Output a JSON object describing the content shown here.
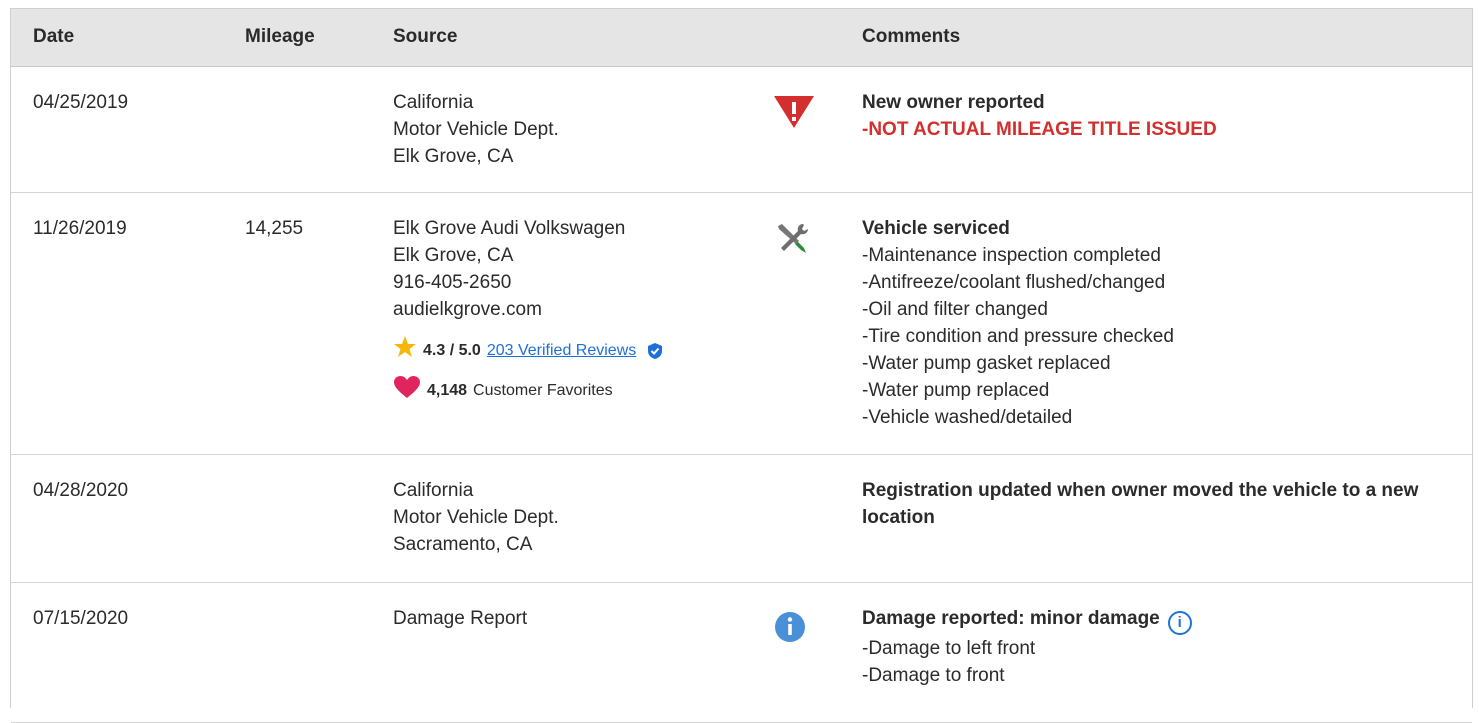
{
  "table": {
    "headers": {
      "date": "Date",
      "mileage": "Mileage",
      "source": "Source",
      "comments": "Comments"
    },
    "rows": [
      {
        "date": "04/25/2019",
        "mileage": "",
        "source": [
          "California",
          "Motor Vehicle Dept.",
          "Elk Grove, CA"
        ],
        "icon": "warning-triangle-icon",
        "comment_title": "New owner reported",
        "comment_items": [
          "-NOT ACTUAL MILEAGE TITLE ISSUED"
        ]
      },
      {
        "date": "11/26/2019",
        "mileage": "14,255",
        "source": [
          "Elk Grove Audi Volkswagen",
          "Elk Grove, CA",
          "916-405-2650",
          "audielkgrove.com"
        ],
        "rating": "4.3 / 5.0",
        "reviews_link": "203 Verified Reviews",
        "favorites_count": "4,148",
        "favorites_label": "Customer Favorites",
        "icon": "service-tools-icon",
        "comment_title": "Vehicle serviced",
        "comment_items": [
          "-Maintenance inspection completed",
          "-Antifreeze/coolant flushed/changed",
          "-Oil and filter changed",
          "-Tire condition and pressure checked",
          "-Water pump gasket replaced",
          "-Water pump replaced",
          "-Vehicle washed/detailed"
        ]
      },
      {
        "date": "04/28/2020",
        "mileage": "",
        "source": [
          "California",
          "Motor Vehicle Dept.",
          "Sacramento, CA"
        ],
        "icon": "",
        "comment_title": "Registration updated when owner moved the vehicle to a new location",
        "comment_items": []
      },
      {
        "date": "07/15/2020",
        "mileage": "",
        "source": [
          "Damage Report"
        ],
        "icon": "info-circle-icon",
        "comment_title": "Damage reported: minor damage",
        "comment_items": [
          "-Damage to left front",
          "-Damage to front"
        ]
      }
    ]
  },
  "colors": {
    "header_bg": "#e5e5e5",
    "alert_red": "#d32f2f",
    "link_blue": "#1e6fd9",
    "info_blue": "#4a90d9",
    "star": "#f5b80a",
    "heart": "#e0245e",
    "wrench_green": "#2e8b3a"
  }
}
